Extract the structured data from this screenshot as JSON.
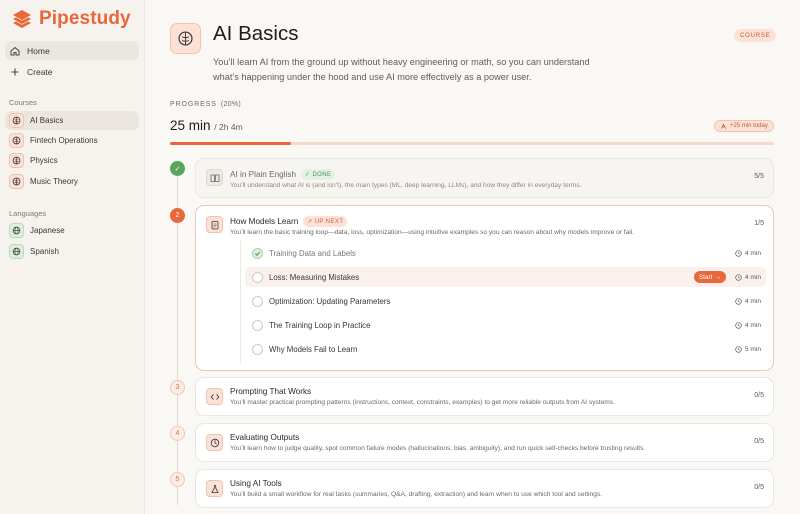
{
  "app": {
    "name": "Pipestudy"
  },
  "nav": {
    "home": "Home",
    "create": "Create"
  },
  "sidebar": {
    "courses_heading": "Courses",
    "courses": [
      {
        "label": "AI Basics"
      },
      {
        "label": "Fintech Operations"
      },
      {
        "label": "Physics"
      },
      {
        "label": "Music Theory"
      }
    ],
    "languages_heading": "Languages",
    "languages": [
      {
        "label": "Japanese"
      },
      {
        "label": "Spanish"
      }
    ]
  },
  "course": {
    "title": "AI Basics",
    "badge": "COURSE",
    "description": "You’ll learn AI from the ground up without heavy engineering or math, so you can understand what’s happening under the hood and use AI more effectively as a power user."
  },
  "progress": {
    "label": "PROGRESS",
    "percent_text": "(20%)",
    "fraction": 0.2,
    "time_done": "25 min",
    "time_total": "/ 2h 4m",
    "today": "+25 min today"
  },
  "modules": [
    {
      "step": "✓",
      "title": "AI in Plain English",
      "tag": "DONE",
      "description": "You’ll understand what AI is (and isn’t), the main types (ML, deep learning, LLMs), and how they differ in everyday terms.",
      "count": "5/5"
    },
    {
      "step": "2",
      "title": "How Models Learn",
      "tag": "UP NEXT",
      "description": "You’ll learn the basic training loop—data, loss, optimization—using intuitive examples so you can reason about why models improve or fail.",
      "count": "1/5",
      "lessons": [
        {
          "title": "Training Data and Labels",
          "duration": "4 min"
        },
        {
          "title": "Loss: Measuring Mistakes",
          "duration": "4 min",
          "action": "Start"
        },
        {
          "title": "Optimization: Updating Parameters",
          "duration": "4 min"
        },
        {
          "title": "The Training Loop in Practice",
          "duration": "4 min"
        },
        {
          "title": "Why Models Fail to Learn",
          "duration": "5 min"
        }
      ]
    },
    {
      "step": "3",
      "title": "Prompting That Works",
      "description": "You’ll master practical prompting patterns (instructions, context, constraints, examples) to get more reliable outputs from AI systems.",
      "count": "0/5"
    },
    {
      "step": "4",
      "title": "Evaluating Outputs",
      "description": "You’ll learn how to judge quality, spot common failure modes (hallucinations, bias, ambiguity), and run quick self-checks before trusting results.",
      "count": "0/5"
    },
    {
      "step": "5",
      "title": "Using AI Tools",
      "description": "You’ll build a small workflow for real tasks (summaries, Q&A, drafting, extraction) and learn when to use which tool and settings.",
      "count": "0/5"
    }
  ]
}
